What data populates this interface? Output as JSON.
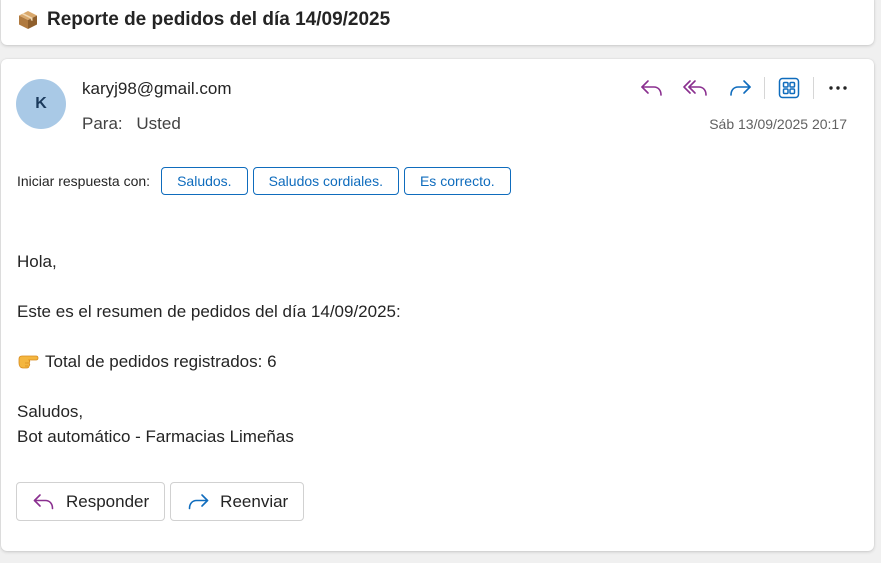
{
  "subject": {
    "icon": "package-icon",
    "text": "Reporte de pedidos del día 14/09/2025"
  },
  "message": {
    "avatar_initial": "K",
    "avatar_color": "#a9c9e6",
    "sender": "karyj98@gmail.com",
    "to_label": "Para:",
    "to_value": "Usted",
    "date": "Sáb 13/09/2025 20:17",
    "actions": [
      "reply-icon",
      "reply-all-icon",
      "forward-icon",
      "apps-icon",
      "more-icon"
    ],
    "quick_replies_label": "Iniciar respuesta con:",
    "quick_replies": [
      "Saludos.",
      "Saludos cordiales.",
      "Es correcto."
    ],
    "body": {
      "greeting": "Hola,",
      "summary": "Este es el resumen de pedidos del día 14/09/2025:",
      "total_icon": "pointing-hand-icon",
      "total": "Total de pedidos registrados: 6",
      "closing": "Saludos,",
      "signature": "Bot automático - Farmacias Limeñas"
    },
    "footer_buttons": {
      "reply": "Responder",
      "forward": "Reenviar"
    }
  },
  "colors": {
    "accent": "#0f6cbd",
    "reply_icon": "#8a2f8f",
    "forward_icon": "#0f6cbd"
  }
}
